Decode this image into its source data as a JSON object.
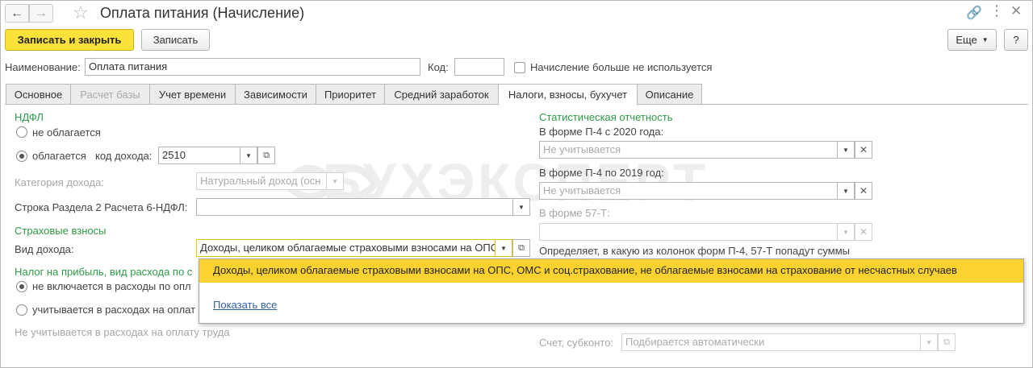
{
  "window": {
    "title": "Оплата питания (Начисление)",
    "back_label": "←",
    "forward_label": "→"
  },
  "toolbar": {
    "save_close_label": "Записать и закрыть",
    "save_label": "Записать",
    "more_label": "Еще",
    "help_label": "?"
  },
  "header_fields": {
    "name_label": "Наименование:",
    "name_value": "Оплата питания",
    "code_label": "Код:",
    "code_value": "",
    "unused_label": "Начисление больше не используется"
  },
  "tabs": [
    {
      "label": "Основное"
    },
    {
      "label": "Расчет базы"
    },
    {
      "label": "Учет времени"
    },
    {
      "label": "Зависимости"
    },
    {
      "label": "Приоритет"
    },
    {
      "label": "Средний заработок"
    },
    {
      "label": "Налоги, взносы, бухучет"
    },
    {
      "label": "Описание"
    }
  ],
  "ndfl": {
    "section_title": "НДФЛ",
    "not_taxed_label": "не облагается",
    "taxed_label": "облагается",
    "income_code_label": "код дохода:",
    "income_code_value": "2510",
    "category_label": "Категория дохода:",
    "category_value": "Натуральный доход (осн",
    "line_6ndfl_label": "Строка Раздела 2 Расчета 6-НДФЛ:",
    "line_6ndfl_value": ""
  },
  "insurance": {
    "section_title": "Страховые взносы",
    "income_type_label": "Вид дохода:",
    "income_type_value": "Доходы, целиком облагаемые страховыми взносами на ОПС"
  },
  "profit_tax": {
    "section_title": "Налог на прибыль, вид расхода по с",
    "option1_label": "не включается в расходы по опл",
    "option2_label": "учитывается в расходах на оплат",
    "note": "Не учитывается в расходах на оплату труда"
  },
  "statistics": {
    "section_title": "Статистическая отчетность",
    "p4_2020_label": "В форме П-4 с 2020 года:",
    "p4_2020_placeholder": "Не учитывается",
    "p4_2019_label": "В форме П-4 по 2019 год:",
    "p4_2019_placeholder": "Не учитывается",
    "f57t_label": "В форме 57-Т:",
    "f57t_value": "",
    "hint": "Определяет, в какую из колонок форм П-4, 57-Т попадут суммы"
  },
  "accounting": {
    "account_label": "Счет, субконто:",
    "account_placeholder": "Подбирается автоматически"
  },
  "dropdown": {
    "selected_item": "Доходы, целиком облагаемые страховыми взносами на ОПС, ОМС и соц.страхование, не облагаемые взносами на страхование от несчастных случаев",
    "show_all_label": "Показать все"
  },
  "watermark": {
    "text": "БУХЭКСПЕРТ"
  },
  "colors": {
    "primary_button": "#fbe23a",
    "section_title": "#2f9a47",
    "dropdown_highlight": "#fbd22f",
    "link": "#3060a8"
  }
}
